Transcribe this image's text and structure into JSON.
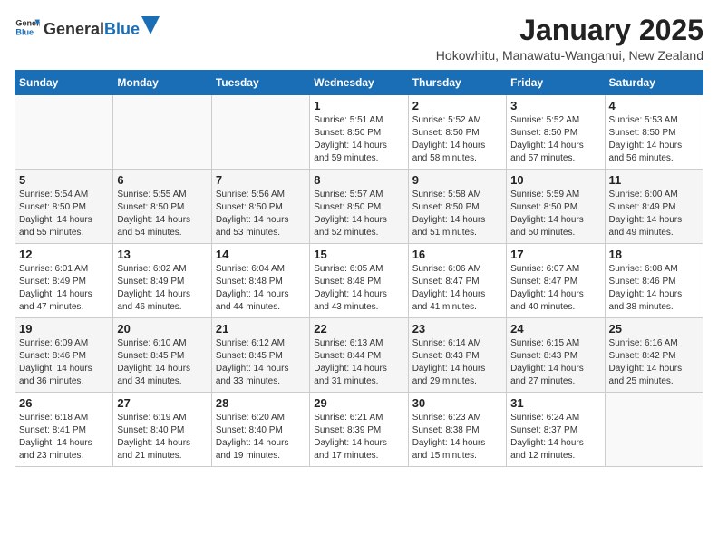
{
  "header": {
    "logo": {
      "general": "General",
      "blue": "Blue"
    },
    "title": "January 2025",
    "subtitle": "Hokowhitu, Manawatu-Wanganui, New Zealand"
  },
  "weekdays": [
    "Sunday",
    "Monday",
    "Tuesday",
    "Wednesday",
    "Thursday",
    "Friday",
    "Saturday"
  ],
  "weeks": [
    [
      {
        "day": "",
        "info": ""
      },
      {
        "day": "",
        "info": ""
      },
      {
        "day": "",
        "info": ""
      },
      {
        "day": "1",
        "info": "Sunrise: 5:51 AM\nSunset: 8:50 PM\nDaylight: 14 hours\nand 59 minutes."
      },
      {
        "day": "2",
        "info": "Sunrise: 5:52 AM\nSunset: 8:50 PM\nDaylight: 14 hours\nand 58 minutes."
      },
      {
        "day": "3",
        "info": "Sunrise: 5:52 AM\nSunset: 8:50 PM\nDaylight: 14 hours\nand 57 minutes."
      },
      {
        "day": "4",
        "info": "Sunrise: 5:53 AM\nSunset: 8:50 PM\nDaylight: 14 hours\nand 56 minutes."
      }
    ],
    [
      {
        "day": "5",
        "info": "Sunrise: 5:54 AM\nSunset: 8:50 PM\nDaylight: 14 hours\nand 55 minutes."
      },
      {
        "day": "6",
        "info": "Sunrise: 5:55 AM\nSunset: 8:50 PM\nDaylight: 14 hours\nand 54 minutes."
      },
      {
        "day": "7",
        "info": "Sunrise: 5:56 AM\nSunset: 8:50 PM\nDaylight: 14 hours\nand 53 minutes."
      },
      {
        "day": "8",
        "info": "Sunrise: 5:57 AM\nSunset: 8:50 PM\nDaylight: 14 hours\nand 52 minutes."
      },
      {
        "day": "9",
        "info": "Sunrise: 5:58 AM\nSunset: 8:50 PM\nDaylight: 14 hours\nand 51 minutes."
      },
      {
        "day": "10",
        "info": "Sunrise: 5:59 AM\nSunset: 8:50 PM\nDaylight: 14 hours\nand 50 minutes."
      },
      {
        "day": "11",
        "info": "Sunrise: 6:00 AM\nSunset: 8:49 PM\nDaylight: 14 hours\nand 49 minutes."
      }
    ],
    [
      {
        "day": "12",
        "info": "Sunrise: 6:01 AM\nSunset: 8:49 PM\nDaylight: 14 hours\nand 47 minutes."
      },
      {
        "day": "13",
        "info": "Sunrise: 6:02 AM\nSunset: 8:49 PM\nDaylight: 14 hours\nand 46 minutes."
      },
      {
        "day": "14",
        "info": "Sunrise: 6:04 AM\nSunset: 8:48 PM\nDaylight: 14 hours\nand 44 minutes."
      },
      {
        "day": "15",
        "info": "Sunrise: 6:05 AM\nSunset: 8:48 PM\nDaylight: 14 hours\nand 43 minutes."
      },
      {
        "day": "16",
        "info": "Sunrise: 6:06 AM\nSunset: 8:47 PM\nDaylight: 14 hours\nand 41 minutes."
      },
      {
        "day": "17",
        "info": "Sunrise: 6:07 AM\nSunset: 8:47 PM\nDaylight: 14 hours\nand 40 minutes."
      },
      {
        "day": "18",
        "info": "Sunrise: 6:08 AM\nSunset: 8:46 PM\nDaylight: 14 hours\nand 38 minutes."
      }
    ],
    [
      {
        "day": "19",
        "info": "Sunrise: 6:09 AM\nSunset: 8:46 PM\nDaylight: 14 hours\nand 36 minutes."
      },
      {
        "day": "20",
        "info": "Sunrise: 6:10 AM\nSunset: 8:45 PM\nDaylight: 14 hours\nand 34 minutes."
      },
      {
        "day": "21",
        "info": "Sunrise: 6:12 AM\nSunset: 8:45 PM\nDaylight: 14 hours\nand 33 minutes."
      },
      {
        "day": "22",
        "info": "Sunrise: 6:13 AM\nSunset: 8:44 PM\nDaylight: 14 hours\nand 31 minutes."
      },
      {
        "day": "23",
        "info": "Sunrise: 6:14 AM\nSunset: 8:43 PM\nDaylight: 14 hours\nand 29 minutes."
      },
      {
        "day": "24",
        "info": "Sunrise: 6:15 AM\nSunset: 8:43 PM\nDaylight: 14 hours\nand 27 minutes."
      },
      {
        "day": "25",
        "info": "Sunrise: 6:16 AM\nSunset: 8:42 PM\nDaylight: 14 hours\nand 25 minutes."
      }
    ],
    [
      {
        "day": "26",
        "info": "Sunrise: 6:18 AM\nSunset: 8:41 PM\nDaylight: 14 hours\nand 23 minutes."
      },
      {
        "day": "27",
        "info": "Sunrise: 6:19 AM\nSunset: 8:40 PM\nDaylight: 14 hours\nand 21 minutes."
      },
      {
        "day": "28",
        "info": "Sunrise: 6:20 AM\nSunset: 8:40 PM\nDaylight: 14 hours\nand 19 minutes."
      },
      {
        "day": "29",
        "info": "Sunrise: 6:21 AM\nSunset: 8:39 PM\nDaylight: 14 hours\nand 17 minutes."
      },
      {
        "day": "30",
        "info": "Sunrise: 6:23 AM\nSunset: 8:38 PM\nDaylight: 14 hours\nand 15 minutes."
      },
      {
        "day": "31",
        "info": "Sunrise: 6:24 AM\nSunset: 8:37 PM\nDaylight: 14 hours\nand 12 minutes."
      },
      {
        "day": "",
        "info": ""
      }
    ]
  ]
}
